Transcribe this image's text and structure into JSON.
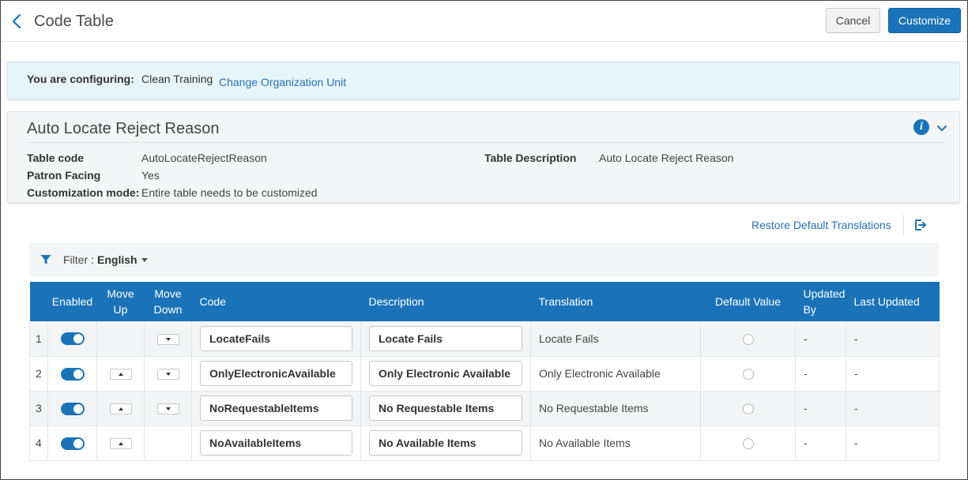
{
  "header": {
    "title": "Code Table",
    "cancel_label": "Cancel",
    "customize_label": "Customize"
  },
  "config": {
    "label": "You are configuring:",
    "value": "Clean Training",
    "change_link": "Change Organization Unit"
  },
  "info": {
    "title": "Auto Locate Reject Reason",
    "table_code_label": "Table code",
    "table_code_value": "AutoLocateRejectReason",
    "patron_facing_label": "Patron Facing",
    "patron_facing_value": "Yes",
    "customization_mode_label": "Customization mode:",
    "customization_mode_value": "Entire table needs to be customized",
    "table_description_label": "Table Description",
    "table_description_value": "Auto Locate Reject Reason"
  },
  "toolbar": {
    "restore_label": "Restore Default Translations"
  },
  "filter": {
    "label": "Filter :",
    "value": "English"
  },
  "table": {
    "headers": {
      "enabled": "Enabled",
      "move_up": "Move Up",
      "move_down": "Move Down",
      "code": "Code",
      "description": "Description",
      "translation": "Translation",
      "default_value": "Default Value",
      "updated_by": "Updated By",
      "last_updated": "Last Updated"
    },
    "rows": [
      {
        "num": "1",
        "enabled": true,
        "move_up": false,
        "move_down": true,
        "code": "LocateFails",
        "description": "Locate Fails",
        "translation": "Locate Fails",
        "default": false,
        "updated_by": "-",
        "last_updated": "-"
      },
      {
        "num": "2",
        "enabled": true,
        "move_up": true,
        "move_down": true,
        "code": "OnlyElectronicAvailable",
        "description": "Only Electronic Available",
        "translation": "Only Electronic Available",
        "default": false,
        "updated_by": "-",
        "last_updated": "-"
      },
      {
        "num": "3",
        "enabled": true,
        "move_up": true,
        "move_down": true,
        "code": "NoRequestableItems",
        "description": "No Requestable Items",
        "translation": "No Requestable Items",
        "default": false,
        "updated_by": "-",
        "last_updated": "-"
      },
      {
        "num": "4",
        "enabled": true,
        "move_up": true,
        "move_down": false,
        "code": "NoAvailableItems",
        "description": "No Available Items",
        "translation": "No Available Items",
        "default": false,
        "updated_by": "-",
        "last_updated": "-"
      }
    ]
  },
  "colors": {
    "primary": "#1a73b8",
    "link": "#2a6fb6",
    "config_bg": "#e6f5fb",
    "panel_bg": "#f4f5f6"
  },
  "icons": {
    "back": "chevron-left-icon",
    "info": "info-icon",
    "collapse": "chevron-down-icon",
    "export": "export-icon",
    "filter": "filter-icon"
  }
}
